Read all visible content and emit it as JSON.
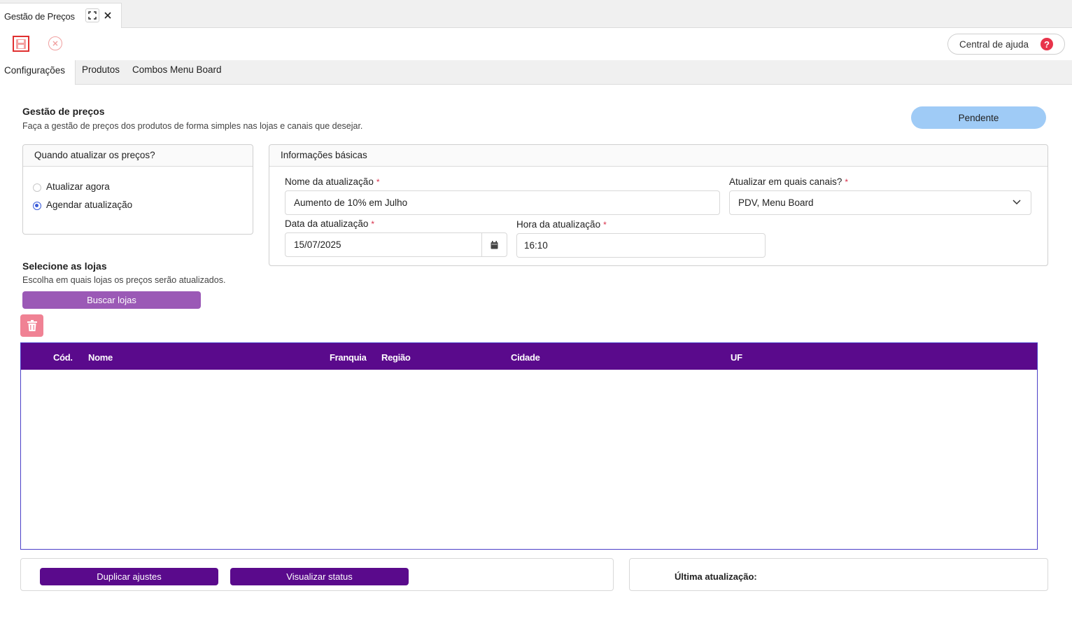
{
  "window_tab": {
    "title": "Gestão de Preços"
  },
  "toolbar": {
    "help_label": "Central de ajuda",
    "help_glyph": "?"
  },
  "section_tabs": [
    "Configurações",
    "Produtos",
    "Combos Menu Board"
  ],
  "header": {
    "title": "Gestão de preços",
    "subtitle": "Faça a gestão de preços dos produtos de forma simples nas lojas e canais que desejar.",
    "status": "Pendente"
  },
  "when_panel": {
    "title": "Quando atualizar os preços?",
    "options": [
      {
        "label": "Atualizar agora",
        "selected": false
      },
      {
        "label": "Agendar atualização",
        "selected": true
      }
    ]
  },
  "basic_info": {
    "title": "Informações básicas",
    "name_label": "Nome da atualização",
    "name_value": "Aumento de 10% em Julho",
    "channels_label": "Atualizar em quais canais?",
    "channels_value": "PDV, Menu Board",
    "date_label": "Data da atualização",
    "date_value": "15/07/2025",
    "time_label": "Hora da atualização",
    "time_value": "16:10",
    "required_mark": "*"
  },
  "stores": {
    "title": "Selecione as lojas",
    "subtitle": "Escolha em quais lojas os preços serão atualizados.",
    "search_button": "Buscar lojas",
    "columns": [
      "Cód.",
      "Nome",
      "Franquia",
      "Região",
      "Cidade",
      "UF"
    ]
  },
  "footer": {
    "duplicate_button": "Duplicar ajustes",
    "status_button": "Visualizar status",
    "last_update_label": "Última atualização:"
  },
  "colors": {
    "primary_purple": "#5a0a8c",
    "light_purple": "#9b59b6",
    "status_blue": "#9fcbf6",
    "danger": "#f08294",
    "required_red": "#d9304a"
  }
}
